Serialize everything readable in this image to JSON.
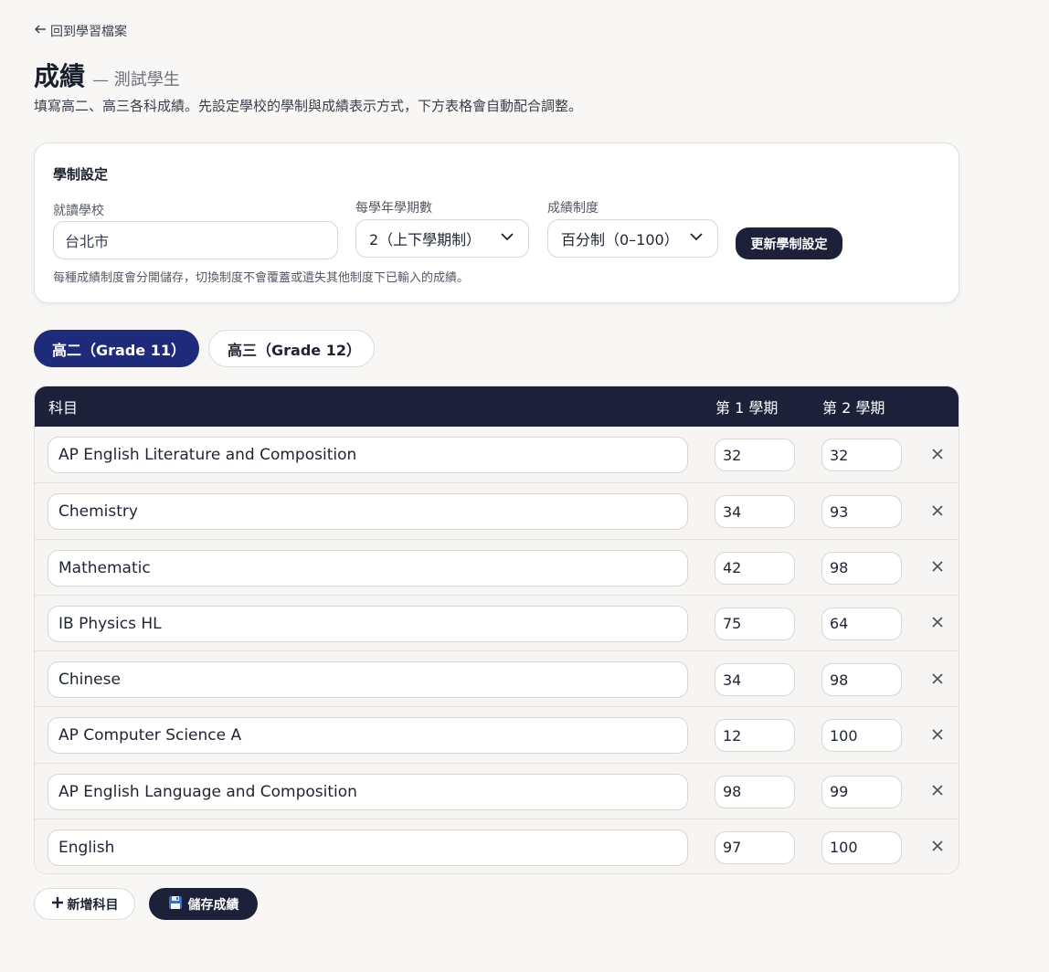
{
  "nav": {
    "back_label": "回到學習檔案"
  },
  "header": {
    "title": "成績",
    "subtitle": "— 測試學生",
    "description": "填寫高二、高三各科成績。先設定學校的學制與成績表示方式，下方表格會自動配合調整。"
  },
  "settings": {
    "title": "學制設定",
    "school_label": "就讀學校",
    "school_value": "台北市",
    "terms_label": "每學年學期數",
    "terms_value": "2（上下學期制）",
    "scale_label": "成績制度",
    "scale_value": "百分制（0–100）",
    "update_button": "更新學制設定",
    "note": "每種成績制度會分開儲存，切換制度不會覆蓋或遺失其他制度下已輸入的成績。"
  },
  "tabs": [
    {
      "label": "高二（Grade 11）",
      "active": true
    },
    {
      "label": "高三（Grade 12）",
      "active": false
    }
  ],
  "table": {
    "headers": {
      "subject": "科目",
      "term1": "第 1 學期",
      "term2": "第 2 學期"
    },
    "rows": [
      {
        "subject": "AP English Literature and Composition",
        "term1": "32",
        "term2": "32"
      },
      {
        "subject": "Chemistry",
        "term1": "34",
        "term2": "93"
      },
      {
        "subject": "Mathematic",
        "term1": "42",
        "term2": "98"
      },
      {
        "subject": "IB Physics HL",
        "term1": "75",
        "term2": "64"
      },
      {
        "subject": "Chinese",
        "term1": "34",
        "term2": "98"
      },
      {
        "subject": "AP Computer Science A",
        "term1": "12",
        "term2": "100"
      },
      {
        "subject": "AP English Language and Composition",
        "term1": "98",
        "term2": "99"
      },
      {
        "subject": "English",
        "term1": "97",
        "term2": "100"
      }
    ]
  },
  "actions": {
    "add_subject": "新增科目",
    "save_grades": "儲存成績"
  },
  "colors": {
    "background": "#f8f7f5",
    "navy": "#1c2139",
    "active_tab": "#1e2a7a"
  }
}
